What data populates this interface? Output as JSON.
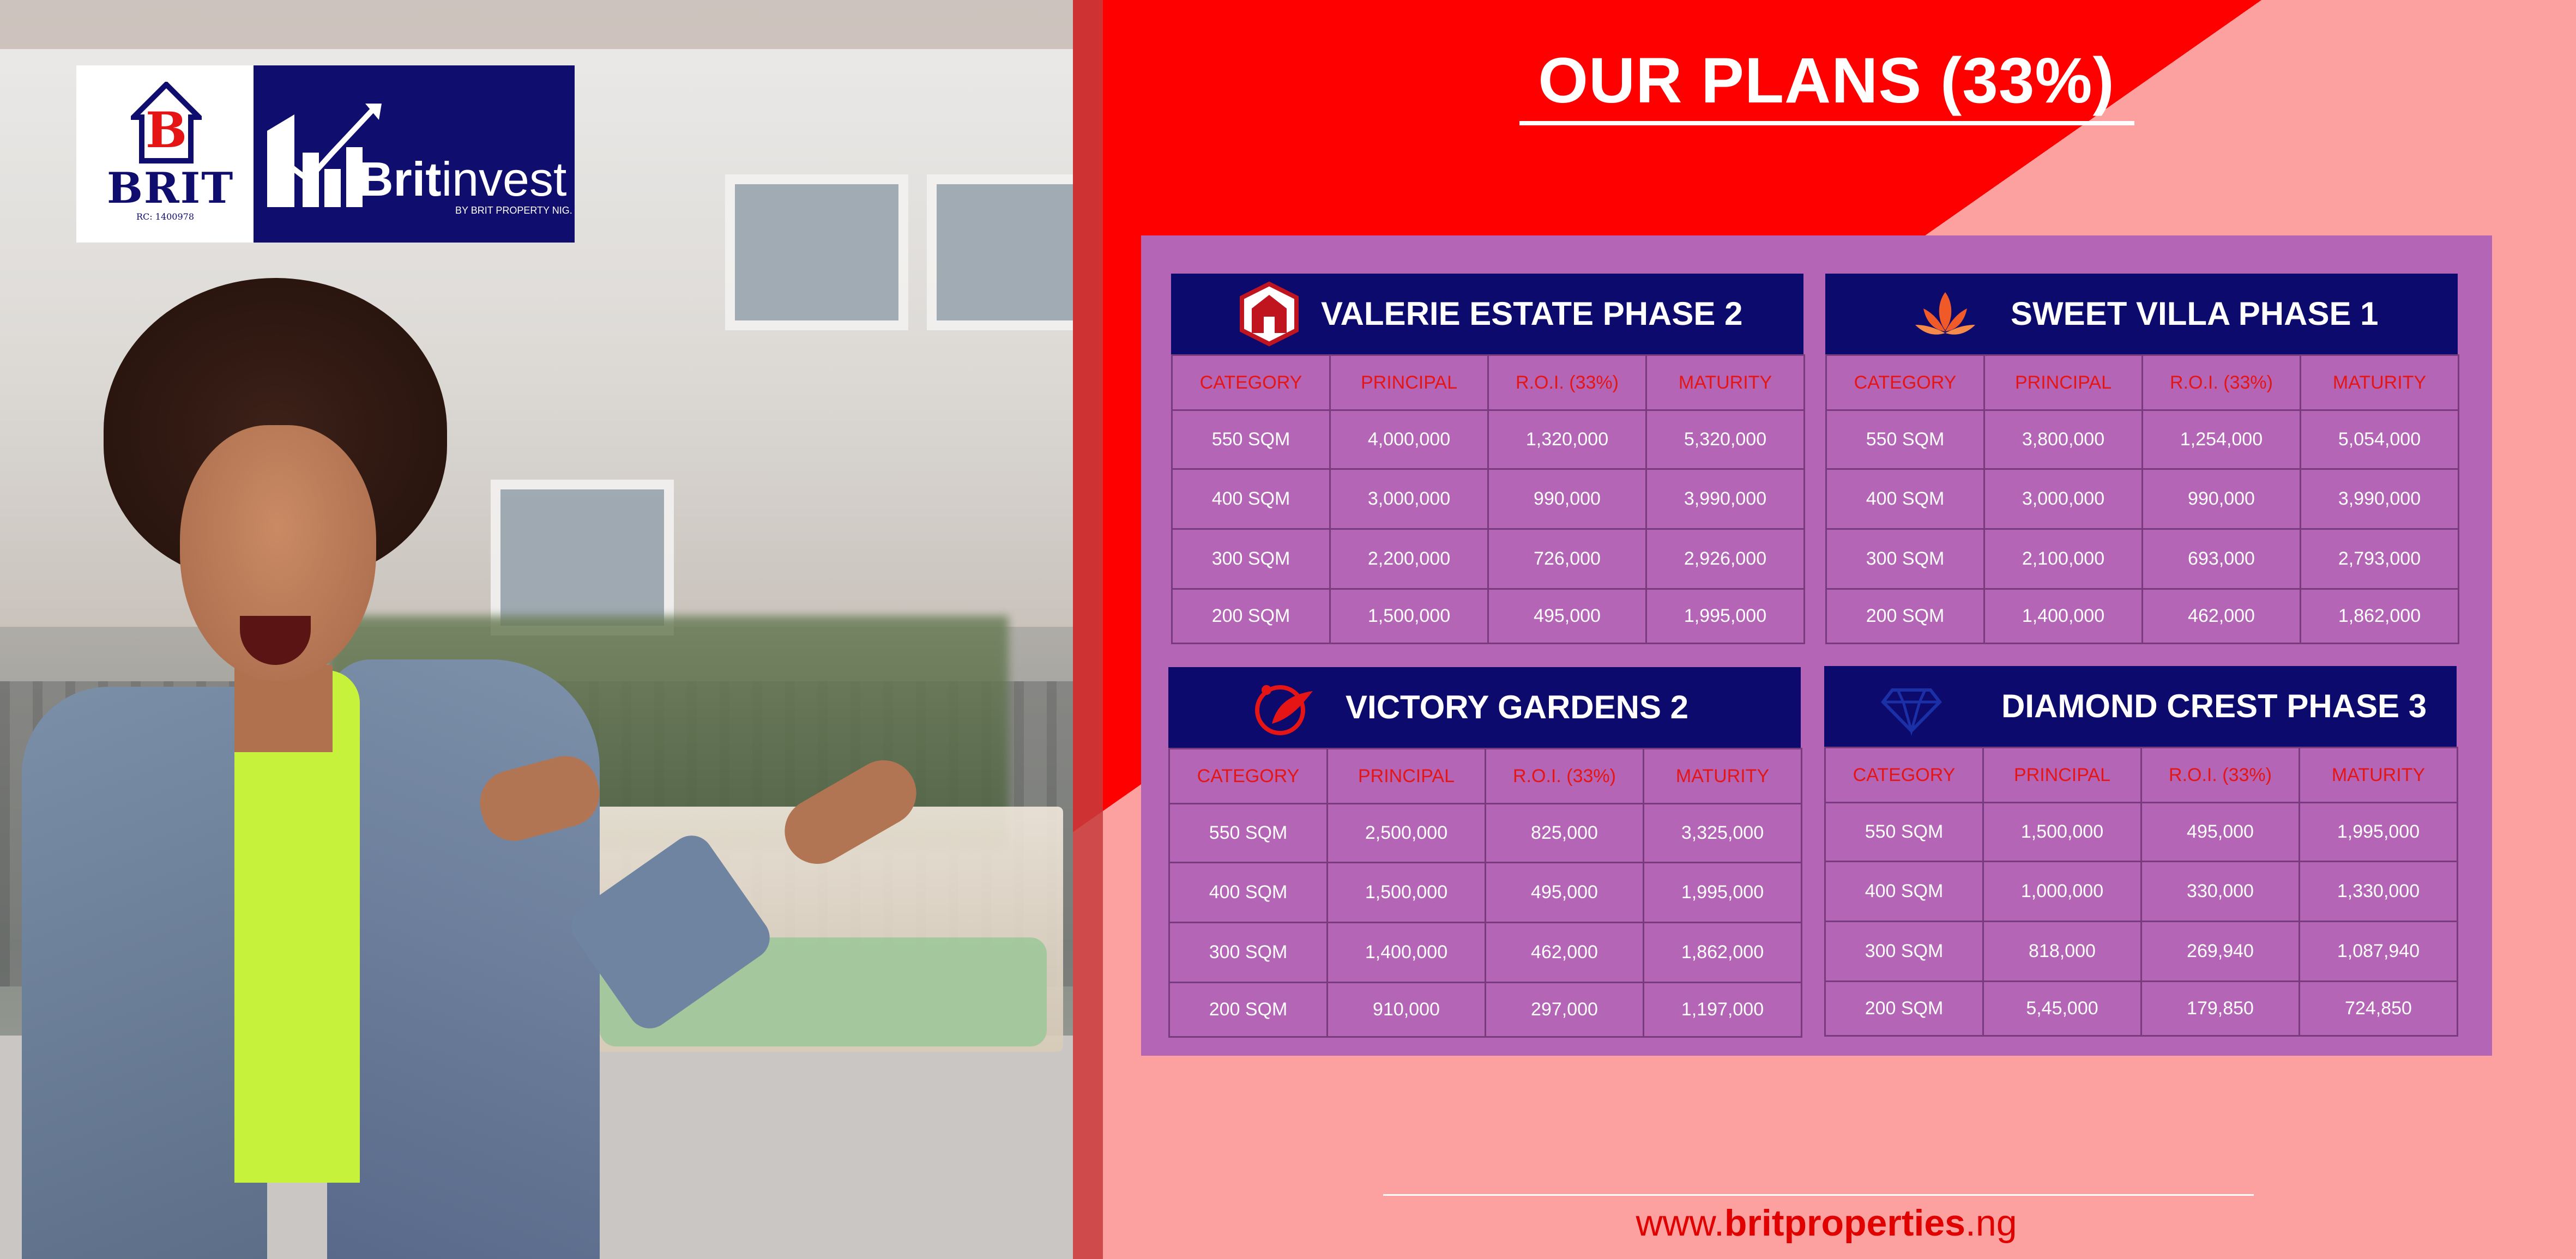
{
  "brand": {
    "logo_left_text": "BRIT",
    "logo_rc": "RC: 1400978",
    "logo_name_bold": "Brit",
    "logo_name_rest": "invest",
    "logo_tagline": "BY BRIT PROPERTY NIG.",
    "colors": {
      "navy": "#0d0a6d",
      "red": "#ff0000",
      "pink": "#fca0a0",
      "purple": "#b465b6"
    }
  },
  "title": "OUR PLANS (33%)",
  "headers": [
    "CATEGORY",
    "PRINCIPAL",
    "R.O.I. (33%)",
    "MATURITY"
  ],
  "plans": [
    {
      "name": "VALERIE ESTATE PHASE 2",
      "icon": "house-shield-icon",
      "rows": [
        [
          "550 SQM",
          "4,000,000",
          "1,320,000",
          "5,320,000"
        ],
        [
          "400 SQM",
          "3,000,000",
          "990,000",
          "3,990,000"
        ],
        [
          "300 SQM",
          "2,200,000",
          "726,000",
          "2,926,000"
        ],
        [
          "200 SQM",
          "1,500,000",
          "495,000",
          "1,995,000"
        ]
      ]
    },
    {
      "name": "SWEET VILLA PHASE 1",
      "icon": "lotus-icon",
      "rows": [
        [
          "550 SQM",
          "3,800,000",
          "1,254,000",
          "5,054,000"
        ],
        [
          "400 SQM",
          "3,000,000",
          "990,000",
          "3,990,000"
        ],
        [
          "300 SQM",
          "2,100,000",
          "693,000",
          "2,793,000"
        ],
        [
          "200 SQM",
          "1,400,000",
          "462,000",
          "1,862,000"
        ]
      ]
    },
    {
      "name": "VICTORY GARDENS 2",
      "icon": "leaf-swoosh-icon",
      "rows": [
        [
          "550 SQM",
          "2,500,000",
          "825,000",
          "3,325,000"
        ],
        [
          "400 SQM",
          "1,500,000",
          "495,000",
          "1,995,000"
        ],
        [
          "300 SQM",
          "1,400,000",
          "462,000",
          "1,862,000"
        ],
        [
          "200 SQM",
          "910,000",
          "297,000",
          "1,197,000"
        ]
      ]
    },
    {
      "name": "DIAMOND CREST PHASE 3",
      "icon": "diamond-icon",
      "rows": [
        [
          "550 SQM",
          "1,500,000",
          "495,000",
          "1,995,000"
        ],
        [
          "400 SQM",
          "1,000,000",
          "330,000",
          "1,330,000"
        ],
        [
          "300 SQM",
          "818,000",
          "269,940",
          "1,087,940"
        ],
        [
          "200 SQM",
          "5,45,000",
          "179,850",
          "724,850"
        ]
      ]
    }
  ],
  "website": {
    "prefix": "www.",
    "domain": "britproperties",
    "suffix": ".ng"
  }
}
